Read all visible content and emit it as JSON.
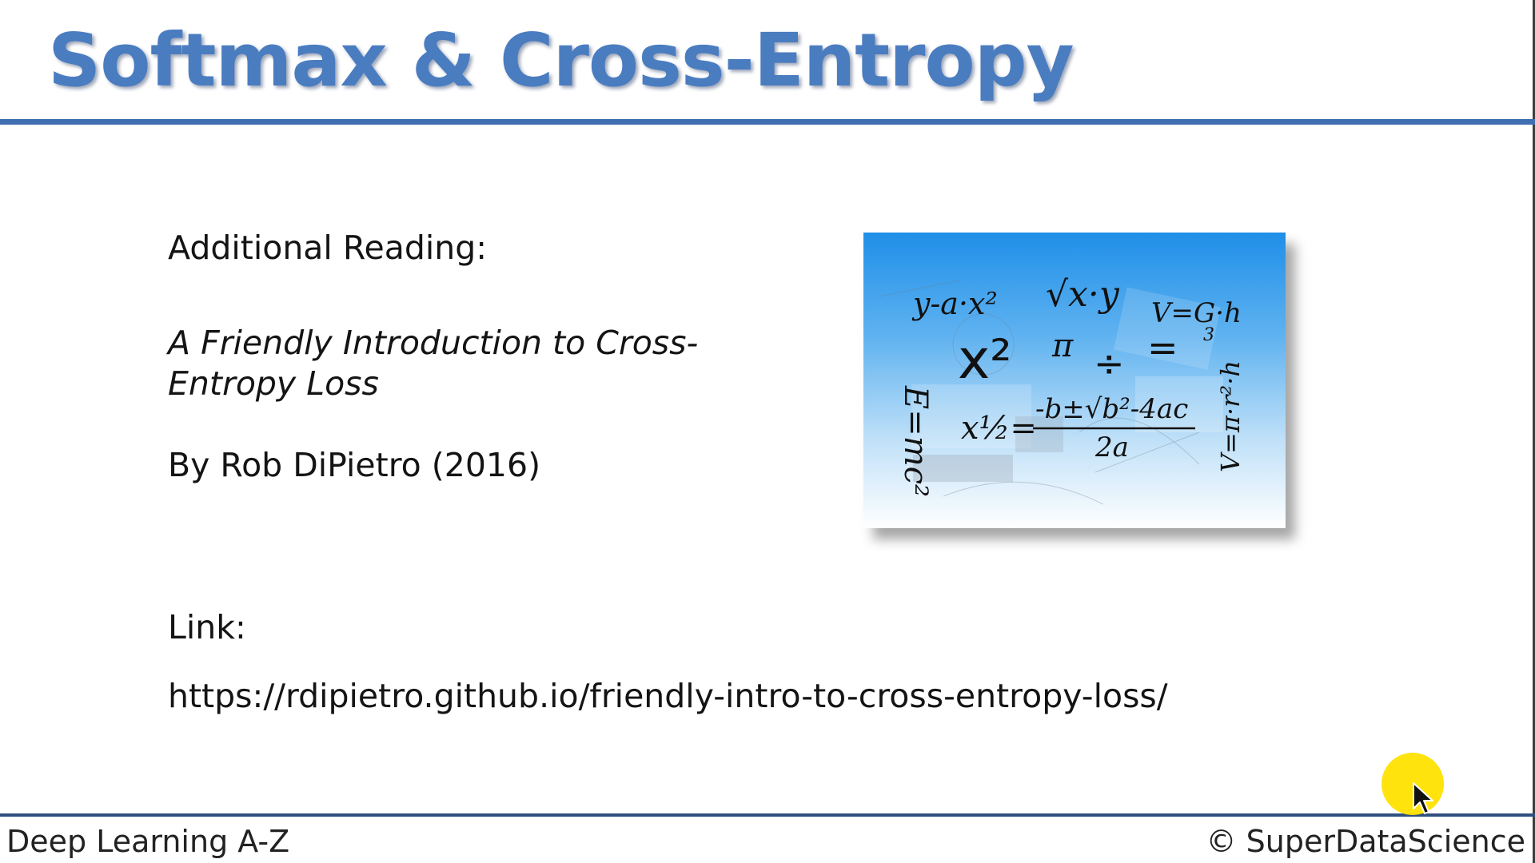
{
  "slide": {
    "title": "Softmax & Cross-Entropy",
    "reading_heading": "Additional Reading:",
    "article_title": "A Friendly Introduction to Cross-Entropy Loss",
    "byline": "By Rob DiPietro (2016)",
    "link_label": "Link:",
    "link_url": "https://rdipietro.github.io/friendly-intro-to-cross-entropy-loss/"
  },
  "image": {
    "description_icon": "math-formulas-image",
    "formulas": {
      "f1": "y-a·x²",
      "f2": "√x·y",
      "f3": "V=G·h",
      "f3b": "3",
      "f4": "x²",
      "f5": "π",
      "f6": "÷",
      "f7": "=",
      "f8": "E=mc²",
      "f9": "x½=",
      "f10": "-b±√b²-4ac",
      "f11": "2a",
      "f12": "V=π·r²·h"
    }
  },
  "footer": {
    "left": "Deep Learning A-Z",
    "right": "© SuperDataScience"
  },
  "colors": {
    "title": "#4a7cc0",
    "rule": "#3f6fb0",
    "cursor_halo": "#ffe200"
  },
  "cursor": {
    "icon": "mouse-pointer-icon"
  }
}
